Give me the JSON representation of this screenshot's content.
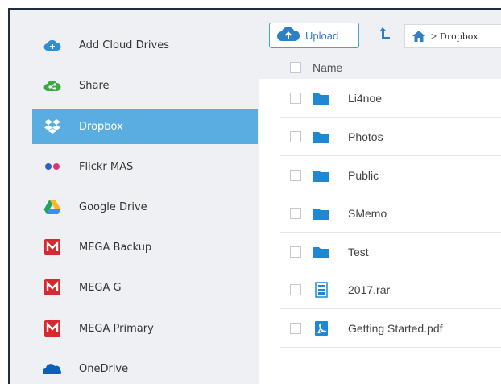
{
  "sidebar": {
    "items": [
      {
        "label": "Add Cloud Drives",
        "icon": "cloud-plus-icon"
      },
      {
        "label": "Share",
        "icon": "share-icon"
      },
      {
        "label": "Dropbox",
        "icon": "dropbox-icon",
        "active": true
      },
      {
        "label": "Flickr MAS",
        "icon": "flickr-icon"
      },
      {
        "label": "Google Drive",
        "icon": "google-drive-icon"
      },
      {
        "label": "MEGA Backup",
        "icon": "mega-icon"
      },
      {
        "label": "MEGA G",
        "icon": "mega-icon"
      },
      {
        "label": "MEGA Primary",
        "icon": "mega-icon"
      },
      {
        "label": "OneDrive",
        "icon": "onedrive-icon"
      }
    ]
  },
  "toolbar": {
    "upload_label": "Upload",
    "breadcrumb": {
      "separator": ">",
      "current": "Dropbox"
    }
  },
  "file_list": {
    "header": {
      "name": "Name"
    },
    "rows": [
      {
        "name": "Li4noe",
        "type": "folder"
      },
      {
        "name": "Photos",
        "type": "folder"
      },
      {
        "name": "Public",
        "type": "folder"
      },
      {
        "name": "SMemo",
        "type": "folder"
      },
      {
        "name": "Test",
        "type": "folder"
      },
      {
        "name": "2017.rar",
        "type": "archive"
      },
      {
        "name": "Getting Started.pdf",
        "type": "pdf"
      }
    ]
  },
  "colors": {
    "accent": "#5aade1",
    "folder": "#1e88d2",
    "mega": "#d9272e",
    "share_green": "#3aa843",
    "sidebar_bg": "#eef0f3"
  }
}
